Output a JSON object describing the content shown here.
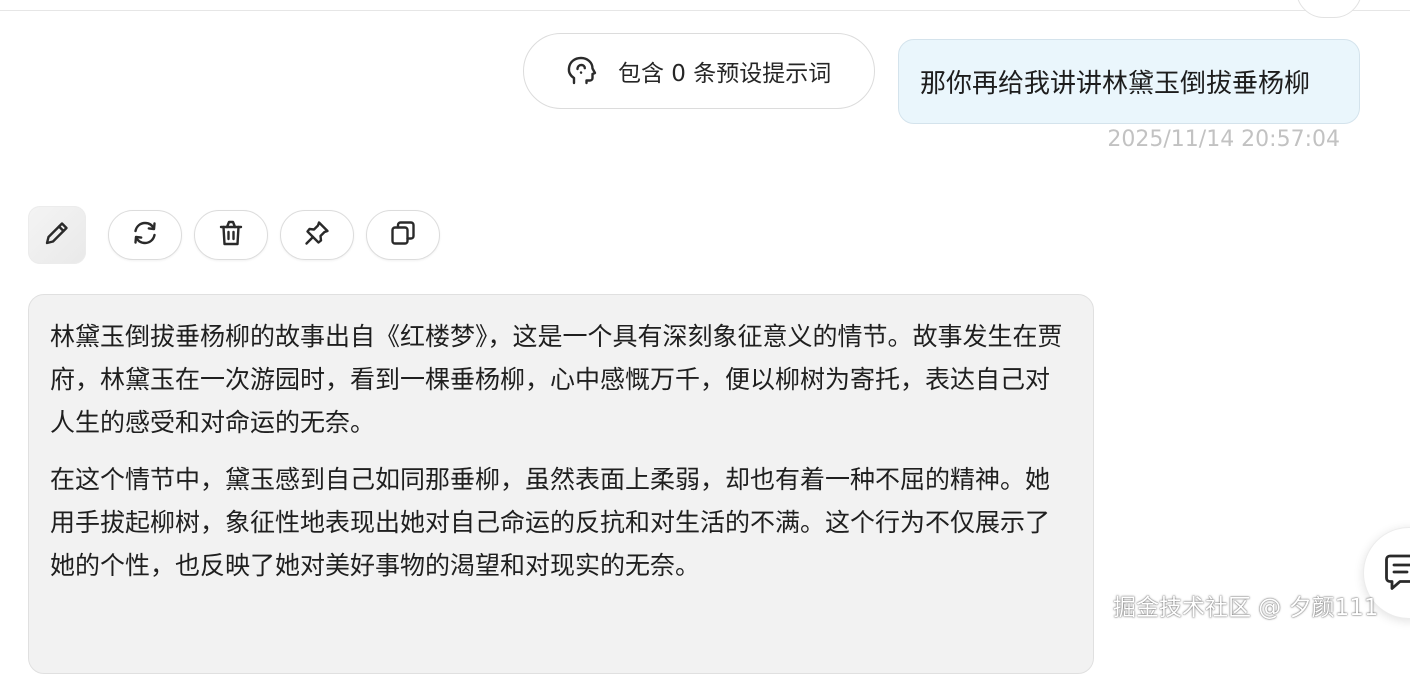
{
  "preset_chip": {
    "label": "包含 0 条预设提示词",
    "icon": "brain-head-icon"
  },
  "user_message": {
    "text": "那你再给我讲讲林黛玉倒拔垂杨柳",
    "timestamp": "2025/11/14 20:57:04"
  },
  "toolbar": {
    "avatar_icon": "pencil-icon",
    "actions": [
      {
        "name": "regenerate",
        "icon": "refresh-icon"
      },
      {
        "name": "delete",
        "icon": "trash-icon"
      },
      {
        "name": "pin",
        "icon": "pin-icon"
      },
      {
        "name": "copy",
        "icon": "copy-icon"
      }
    ]
  },
  "assistant_message": {
    "paragraphs": [
      "林黛玉倒拔垂杨柳的故事出自《红楼梦》，这是一个具有深刻象征意义的情节。故事发生在贾府，林黛玉在一次游园时，看到一棵垂杨柳，心中感慨万千，便以柳树为寄托，表达自己对人生的感受和对命运的无奈。",
      "在这个情节中，黛玉感到自己如同那垂柳，虽然表面上柔弱，却也有着一种不屈的精神。她用手拔起柳树，象征性地表现出她对自己命运的反抗和对生活的不满。这个行为不仅展示了她的个性，也反映了她对美好事物的渴望和对现实的无奈。"
    ]
  },
  "floating_button": {
    "icon": "chat-bubble-icon"
  },
  "watermark": "掘金技术社区 @ 夕颜111"
}
